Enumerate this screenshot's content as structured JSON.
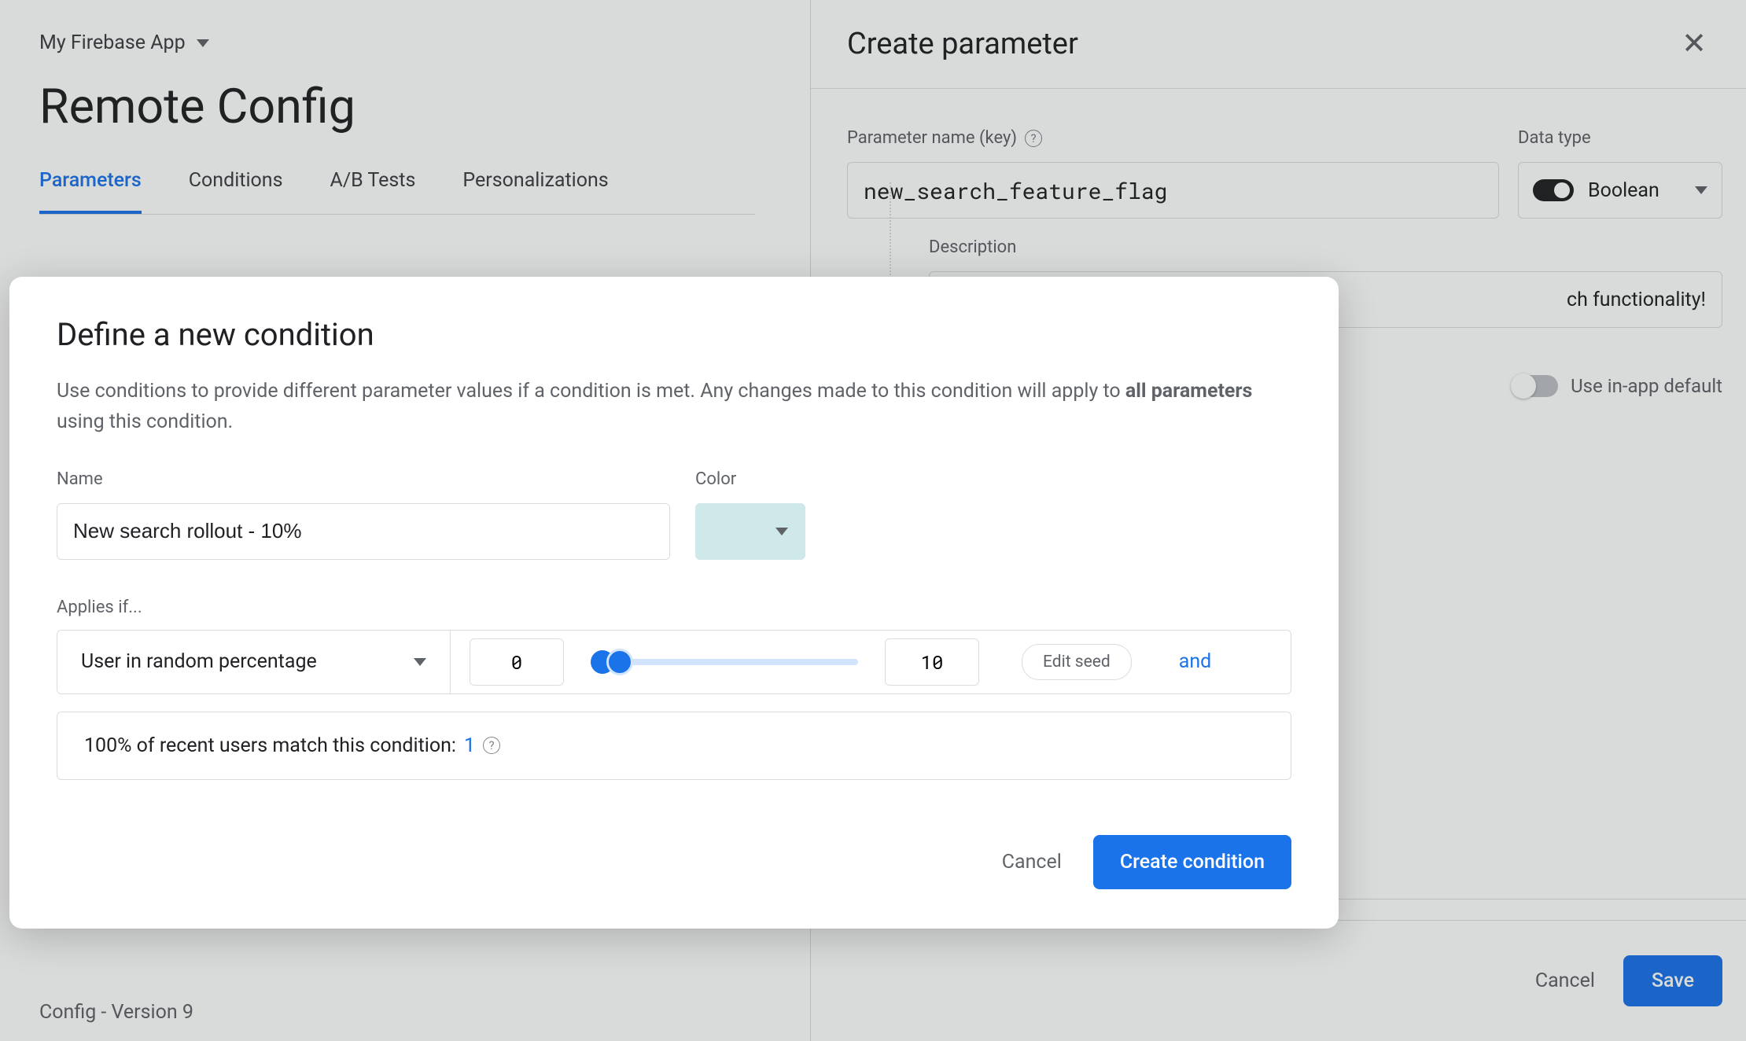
{
  "header": {
    "app_name": "My Firebase App",
    "page_title": "Remote Config"
  },
  "tabs": {
    "items": [
      "Parameters",
      "Conditions",
      "A/B Tests",
      "Personalizations"
    ],
    "active_index": 0
  },
  "sidepanel": {
    "title": "Create parameter",
    "param_label": "Parameter name (key)",
    "param_value": "new_search_feature_flag",
    "datatype_label": "Data type",
    "datatype_value": "Boolean",
    "desc_label": "Description",
    "desc_value_visible": "ch functionality!",
    "inapp_label": "Use in-app default",
    "cancel": "Cancel",
    "save": "Save"
  },
  "dialog": {
    "title": "Define a new condition",
    "sub_pre": "Use conditions to provide different parameter values if a condition is met. Any changes made to this condition will apply to ",
    "sub_bold": "all parameters",
    "sub_post": " using this condition.",
    "name_label": "Name",
    "name_value": "New search rollout - 10%",
    "color_label": "Color",
    "color_hex": "#cfe8ea",
    "applies_label": "Applies if...",
    "condition_type": "User in random percentage",
    "range_low": "0",
    "range_high": "10",
    "edit_seed": "Edit seed",
    "and": "and",
    "match_text_pre": "100% of recent users match this condition: ",
    "match_count": "1",
    "cancel": "Cancel",
    "create": "Create condition"
  },
  "footer": {
    "version": "Config - Version 9"
  }
}
